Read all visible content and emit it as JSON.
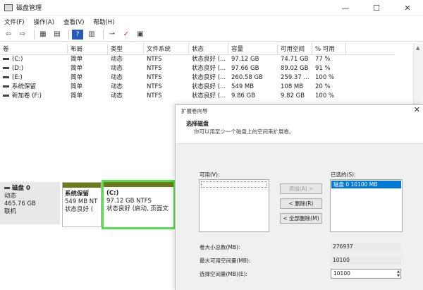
{
  "window": {
    "title": "磁盘管理",
    "min": "—",
    "max": "☐",
    "close": "✕"
  },
  "menu": [
    "文件(F)",
    "操作(A)",
    "查看(V)",
    "帮助(H)"
  ],
  "table": {
    "headers": [
      "卷",
      "布局",
      "类型",
      "文件系统",
      "状态",
      "容量",
      "可用空间",
      "% 可用"
    ],
    "rows": [
      [
        "(C:)",
        "简单",
        "动态",
        "NTFS",
        "状态良好 (...",
        "97.12 GB",
        "74.71 GB",
        "77 %"
      ],
      [
        "(D:)",
        "简单",
        "动态",
        "NTFS",
        "状态良好 (...",
        "97.66 GB",
        "89.02 GB",
        "91 %"
      ],
      [
        "(E:)",
        "简单",
        "动态",
        "NTFS",
        "状态良好 (...",
        "260.58 GB",
        "259.37 ...",
        "100 %"
      ],
      [
        "系统保留",
        "简单",
        "动态",
        "NTFS",
        "状态良好 (...",
        "549 MB",
        "108 MB",
        "20 %"
      ],
      [
        "新加卷 (F:)",
        "简单",
        "动态",
        "NTFS",
        "状态良好 (...",
        "9.86 GB",
        "9.82 GB",
        "100 %"
      ]
    ]
  },
  "disk": {
    "name": "磁盘 0",
    "type": "动态",
    "size": "465.76 GB",
    "status": "联机",
    "partitions": [
      {
        "name": "系统保留",
        "size": "549 MB NT",
        "status": "状态良好 ("
      },
      {
        "name": "(C:)",
        "size": "97.12 GB NTFS",
        "status": "状态良好 (启动, 页面文"
      }
    ]
  },
  "dialog": {
    "title": "扩展卷向导",
    "close": "✕",
    "heading": "选择磁盘",
    "subheading": "你可以用至少一个磁盘上的空间来扩展卷。",
    "available_label": "可用(V):",
    "selected_label": "已选的(S):",
    "selected_item": "磁盘 0     10100 MB",
    "btn_add": "添加(A) >",
    "btn_remove": "< 删除(R)",
    "btn_remove_all": "< 全部删除(M)",
    "total_label": "卷大小总数(MB):",
    "total_value": "276937",
    "max_label": "最大可用空间量(MB):",
    "max_value": "10100",
    "select_label": "选择空间量(MB)(E):",
    "select_value": "10100"
  },
  "colors": {
    "highlight_border": "#54e04a",
    "partition_bar": "#6b7a1a",
    "selection": "#0078d7",
    "arrow": "#e8541c"
  }
}
